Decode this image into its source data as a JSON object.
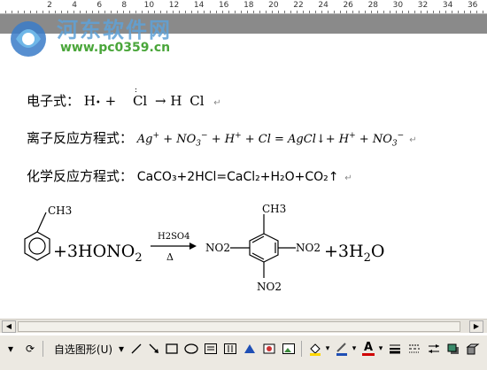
{
  "ruler": {
    "labels": [
      "2",
      "4",
      "6",
      "8",
      "10",
      "12",
      "14",
      "16",
      "18",
      "20",
      "22",
      "24",
      "26",
      "28",
      "30",
      "32",
      "34",
      "36"
    ]
  },
  "watermark": {
    "title": "河东软件网",
    "url": "www.pc0359.cn"
  },
  "document": {
    "electron_label": "电子式：",
    "electron_h": "H",
    "electron_plus": "+",
    "electron_cl": "Cl",
    "electron_arrow": "→",
    "electron_product_h": "H",
    "electron_product_cl": "Cl",
    "ionic_label": "离子反应方程式：",
    "ionic_eq_part1": "Ag",
    "ionic_eq_part2": "+ NO",
    "ionic_eq_part3": "+ H",
    "ionic_eq_part4": "+ Cl = AgCl↓+ H",
    "ionic_eq_part5": "+ NO",
    "sup_plus": "+",
    "sup_minus": "−",
    "sub_3": "3",
    "chem_label": "化学反应方程式：",
    "chem_equation": "CaCO₃+2HCl=CaCl₂+H₂O+CO₂↑",
    "reaction": {
      "ch3_top": "CH3",
      "plus_reagent": "+3HONO",
      "reagent_sub": "2",
      "catalyst": "H2SO4",
      "heat": "Δ",
      "no2_left": "NO2",
      "ch3_product": "CH3",
      "no2_right": "NO2",
      "no2_bottom": "NO2",
      "water_plus": "+3H",
      "water_sub": "2",
      "water_o": "O"
    },
    "para_mark": "↵"
  },
  "toolbar": {
    "autoshapes_label": "自选图形(U)",
    "font_color_letter": "A"
  }
}
